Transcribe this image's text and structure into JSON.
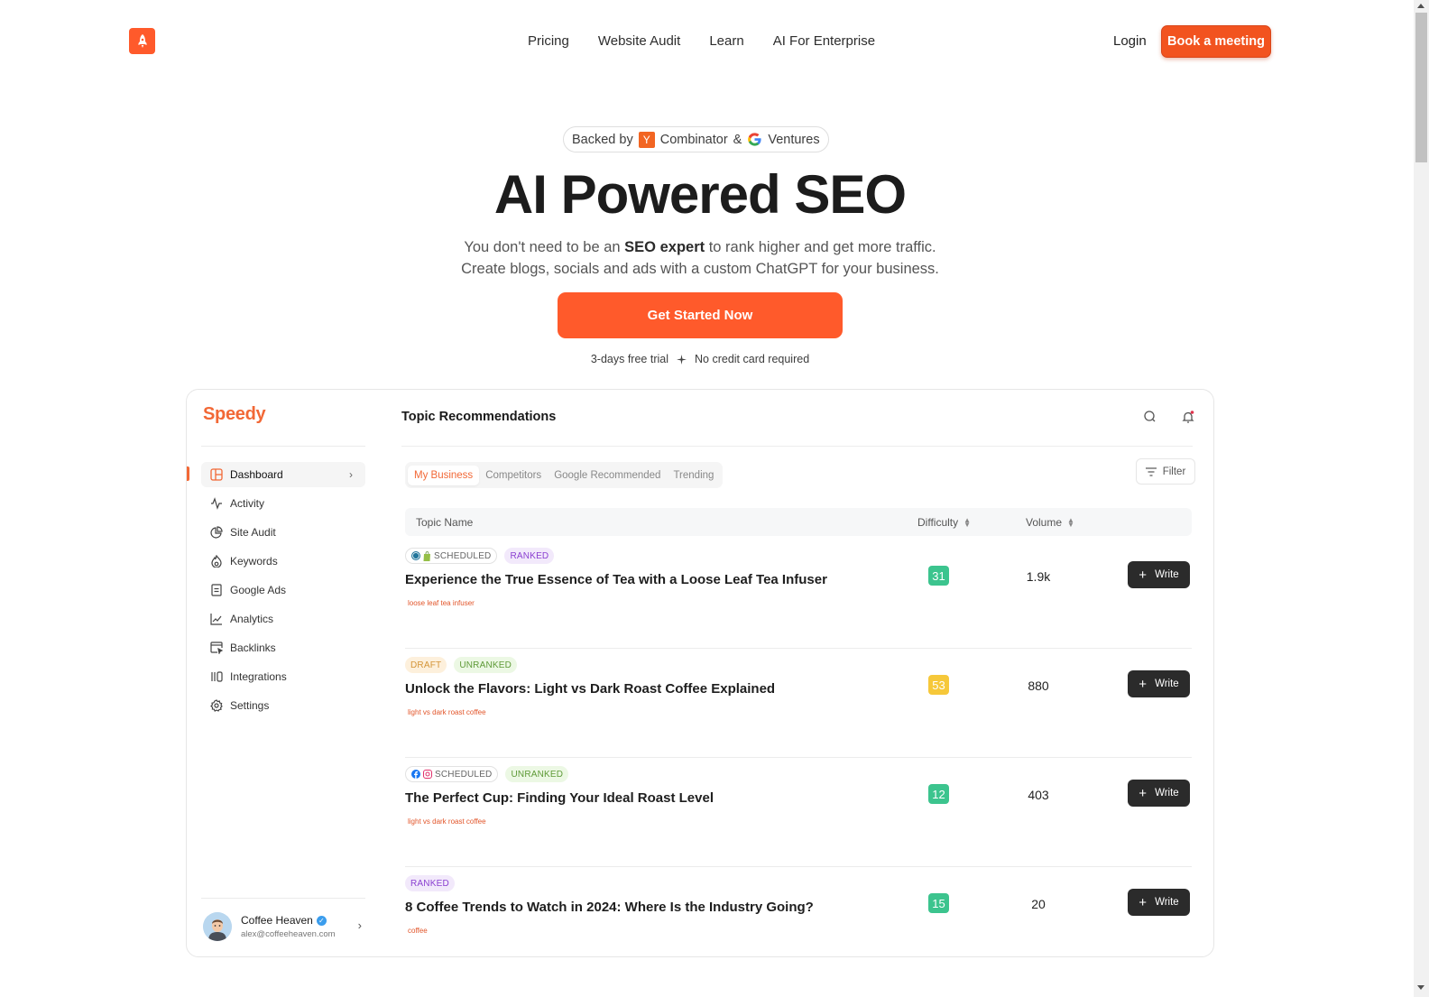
{
  "nav": {
    "logo_icon": "rocket-icon",
    "links": [
      "Pricing",
      "Website Audit",
      "Learn",
      "AI For Enterprise"
    ],
    "login": "Login",
    "book_meeting": "Book a meeting"
  },
  "hero": {
    "backed_by": "Backed by",
    "yc_letter": "Y",
    "combinator": "Combinator",
    "ampersand": "&",
    "ventures": "Ventures",
    "title": "AI Powered SEO",
    "subtitle_pre": "You don't need to be an ",
    "subtitle_bold": "SEO expert",
    "subtitle_post": " to rank higher and get more traffic.",
    "subtitle_line2": "Create blogs, socials and ads with a custom ChatGPT for your business.",
    "cta": "Get Started Now",
    "trial": "3-days free trial",
    "no_card": "No credit card required"
  },
  "app": {
    "brand": "Speedy",
    "title": "Topic Recommendations",
    "sidebar": {
      "items": [
        {
          "label": "Dashboard",
          "icon": "dashboard-icon",
          "active": true
        },
        {
          "label": "Activity",
          "icon": "activity-icon"
        },
        {
          "label": "Site Audit",
          "icon": "pie-chart-icon"
        },
        {
          "label": "Keywords",
          "icon": "flame-icon"
        },
        {
          "label": "Google Ads",
          "icon": "document-icon"
        },
        {
          "label": "Analytics",
          "icon": "line-chart-icon"
        },
        {
          "label": "Backlinks",
          "icon": "browser-cursor-icon"
        },
        {
          "label": "Integrations",
          "icon": "integrations-icon"
        },
        {
          "label": "Settings",
          "icon": "gear-icon"
        }
      ]
    },
    "user": {
      "name": "Coffee Heaven",
      "email": "alex@coffeeheaven.com",
      "verified": true
    },
    "tabs": [
      "My Business",
      "Competitors",
      "Google Recommended",
      "Trending"
    ],
    "active_tab": "My Business",
    "filter": "Filter",
    "table": {
      "headers": {
        "topic": "Topic Name",
        "difficulty": "Difficulty",
        "volume": "Volume"
      },
      "write_label": "Write",
      "rows": [
        {
          "status": "SCHEDULED",
          "status_type": "scheduled",
          "platforms": [
            "wordpress",
            "shopify"
          ],
          "rank": "RANKED",
          "rank_type": "ranked",
          "title": "Experience the True Essence of Tea with a Loose Leaf Tea Infuser",
          "keyword": "loose leaf tea infuser",
          "difficulty": "31",
          "difficulty_color": "#3cc48e",
          "volume": "1.9k"
        },
        {
          "status": "DRAFT",
          "status_type": "draft",
          "platforms": [],
          "rank": "UNRANKED",
          "rank_type": "unranked",
          "title": "Unlock the Flavors: Light vs Dark Roast Coffee Explained",
          "keyword": "light vs dark roast coffee",
          "difficulty": "53",
          "difficulty_color": "#f6c83a",
          "volume": "880"
        },
        {
          "status": "SCHEDULED",
          "status_type": "scheduled",
          "platforms": [
            "facebook",
            "instagram"
          ],
          "rank": "UNRANKED",
          "rank_type": "unranked",
          "title": "The Perfect Cup: Finding Your Ideal Roast Level",
          "keyword": "light vs dark roast coffee",
          "difficulty": "12",
          "difficulty_color": "#3cc48e",
          "volume": "403"
        },
        {
          "status": "",
          "status_type": "",
          "platforms": [],
          "rank": "RANKED",
          "rank_type": "ranked",
          "title": "8 Coffee Trends to Watch in 2024: Where Is the Industry Going?",
          "keyword": "coffee",
          "difficulty": "15",
          "difficulty_color": "#3cc48e",
          "volume": "20"
        }
      ]
    }
  },
  "colors": {
    "brand_orange": "#ff5a2b",
    "easy": "#3cc48e",
    "medium": "#f6c83a"
  }
}
